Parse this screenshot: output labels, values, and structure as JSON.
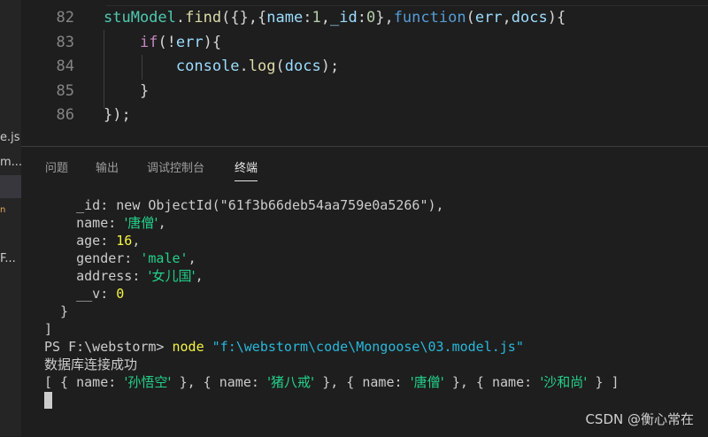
{
  "sidebar": {
    "fragments": [
      {
        "text": "e.js",
        "kind": "file"
      },
      {
        "text": "m...",
        "kind": "file"
      },
      {
        "text": "n",
        "kind": "icon"
      },
      {
        "text": "F...",
        "kind": "file"
      }
    ]
  },
  "editor": {
    "lines": [
      {
        "number": "82",
        "tokens": [
          {
            "t": "stuModel",
            "c": "t-var"
          },
          {
            "t": ".",
            "c": "t-punc"
          },
          {
            "t": "find",
            "c": "t-fn"
          },
          {
            "t": "({},{",
            "c": "t-punc"
          },
          {
            "t": "name",
            "c": "t-prop"
          },
          {
            "t": ":",
            "c": "t-punc"
          },
          {
            "t": "1",
            "c": "t-num"
          },
          {
            "t": ",",
            "c": "t-punc"
          },
          {
            "t": "_id",
            "c": "t-prop"
          },
          {
            "t": ":",
            "c": "t-punc"
          },
          {
            "t": "0",
            "c": "t-num"
          },
          {
            "t": "},",
            "c": "t-punc"
          },
          {
            "t": "function",
            "c": "t-kw"
          },
          {
            "t": "(",
            "c": "t-punc"
          },
          {
            "t": "err",
            "c": "t-prop"
          },
          {
            "t": ",",
            "c": "t-punc"
          },
          {
            "t": "docs",
            "c": "t-prop"
          },
          {
            "t": "){",
            "c": "t-punc"
          }
        ]
      },
      {
        "number": "83",
        "tokens": [
          {
            "t": "    ",
            "c": "t-punc"
          },
          {
            "t": "if",
            "c": "t-ctrl"
          },
          {
            "t": "(!",
            "c": "t-punc"
          },
          {
            "t": "err",
            "c": "t-prop"
          },
          {
            "t": "){",
            "c": "t-punc"
          }
        ]
      },
      {
        "number": "84",
        "tokens": [
          {
            "t": "        ",
            "c": "t-punc"
          },
          {
            "t": "console",
            "c": "t-prop"
          },
          {
            "t": ".",
            "c": "t-punc"
          },
          {
            "t": "log",
            "c": "t-fn"
          },
          {
            "t": "(",
            "c": "t-punc"
          },
          {
            "t": "docs",
            "c": "t-prop"
          },
          {
            "t": ");",
            "c": "t-punc"
          }
        ]
      },
      {
        "number": "85",
        "tokens": [
          {
            "t": "    }",
            "c": "t-punc"
          }
        ]
      },
      {
        "number": "86",
        "tokens": [
          {
            "t": "});",
            "c": "t-punc"
          }
        ]
      }
    ]
  },
  "panel": {
    "tabs": [
      {
        "label": "问题",
        "active": false
      },
      {
        "label": "输出",
        "active": false
      },
      {
        "label": "调试控制台",
        "active": false
      },
      {
        "label": "终端",
        "active": true
      }
    ]
  },
  "terminal": {
    "lines": [
      [
        {
          "t": "    _id: new ObjectId(\"61f3b66deb54aa759e0a5266\"),",
          "c": ""
        }
      ],
      [
        {
          "t": "    name: ",
          "c": ""
        },
        {
          "t": "'唐僧'",
          "c": "green cn"
        },
        {
          "t": ",",
          "c": ""
        }
      ],
      [
        {
          "t": "    age: ",
          "c": ""
        },
        {
          "t": "16",
          "c": "yel"
        },
        {
          "t": ",",
          "c": ""
        }
      ],
      [
        {
          "t": "    gender: ",
          "c": ""
        },
        {
          "t": "'male'",
          "c": "green"
        },
        {
          "t": ",",
          "c": ""
        }
      ],
      [
        {
          "t": "    address: ",
          "c": ""
        },
        {
          "t": "'女儿国'",
          "c": "green cn"
        },
        {
          "t": ",",
          "c": ""
        }
      ],
      [
        {
          "t": "    __v: ",
          "c": ""
        },
        {
          "t": "0",
          "c": "yel"
        }
      ],
      [
        {
          "t": "  }",
          "c": ""
        }
      ],
      [
        {
          "t": "]",
          "c": ""
        }
      ],
      [
        {
          "t": "PS F:\\webstorm> ",
          "c": ""
        },
        {
          "t": "node",
          "c": "yel"
        },
        {
          "t": " ",
          "c": ""
        },
        {
          "t": "\"f:\\webstorm\\code\\Mongoose\\03.model.js\"",
          "c": "str"
        }
      ],
      [
        {
          "t": "数据库连接成功",
          "c": "cn"
        }
      ],
      [
        {
          "t": "[ { name: ",
          "c": ""
        },
        {
          "t": "'孙悟空'",
          "c": "green cn"
        },
        {
          "t": " }, { name: ",
          "c": ""
        },
        {
          "t": "'猪八戒'",
          "c": "green cn"
        },
        {
          "t": " }, { name: ",
          "c": ""
        },
        {
          "t": "'唐僧'",
          "c": "green cn"
        },
        {
          "t": " }, { name: ",
          "c": ""
        },
        {
          "t": "'沙和尚'",
          "c": "green cn"
        },
        {
          "t": " } ]",
          "c": ""
        }
      ]
    ]
  },
  "watermark": "CSDN @衡心常在"
}
